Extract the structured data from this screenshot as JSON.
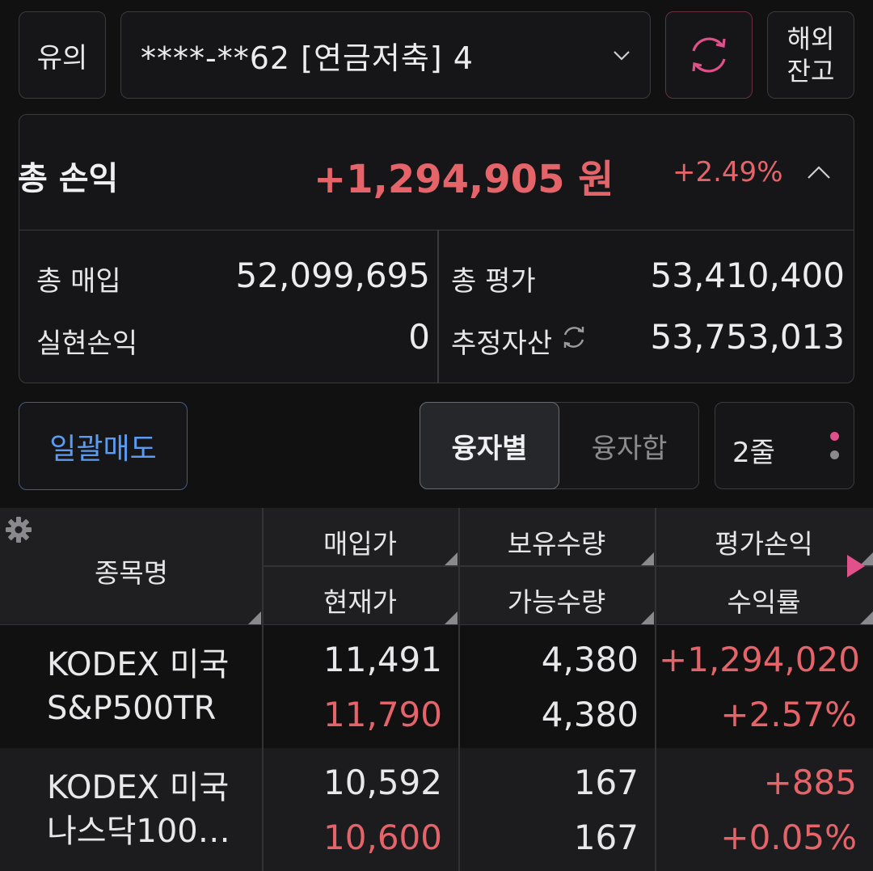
{
  "top_bar": {
    "notice_label": "유의",
    "account_label": "****-**62 [연금저축] 4",
    "overseas_label_line1": "해외",
    "overseas_label_line2": "잔고"
  },
  "summary": {
    "total_pl_label": "총 손익",
    "total_pl_value": "+1,294,905 원",
    "total_pl_rate": "+2.49%",
    "total_buy_label": "총 매입",
    "total_buy_value": "52,099,695",
    "total_eval_label": "총 평가",
    "total_eval_value": "53,410,400",
    "realized_label": "실현손익",
    "realized_value": "0",
    "est_asset_label": "추정자산",
    "est_asset_value": "53,753,013"
  },
  "actions": {
    "bulk_sell_label": "일괄매도",
    "seg_by_loan_label": "융자별",
    "seg_loan_sum_label": "융자합",
    "rows_label": "2줄"
  },
  "table": {
    "headers": {
      "name": "종목명",
      "buy_price": "매입가",
      "current_price": "현재가",
      "holding_qty": "보유수량",
      "available_qty": "가능수량",
      "eval_pl": "평가손익",
      "return_rate": "수익률"
    },
    "rows": [
      {
        "name_line1": "KODEX 미국",
        "name_line2": "S&P500TR",
        "buy_price": "11,491",
        "current_price": "11,790",
        "holding_qty": "4,380",
        "available_qty": "4,380",
        "eval_pl": "+1,294,020",
        "return_rate": "+2.57%"
      },
      {
        "name_line1": "KODEX 미국",
        "name_line2": "나스닥100…",
        "buy_price": "10,592",
        "current_price": "10,600",
        "holding_qty": "167",
        "available_qty": "167",
        "eval_pl": "+885",
        "return_rate": "+0.05%"
      }
    ]
  },
  "colors": {
    "profit_red": "#e4646a",
    "accent_blue": "#5b9bf0",
    "accent_pink": "#e0508a",
    "background": "#111112"
  }
}
